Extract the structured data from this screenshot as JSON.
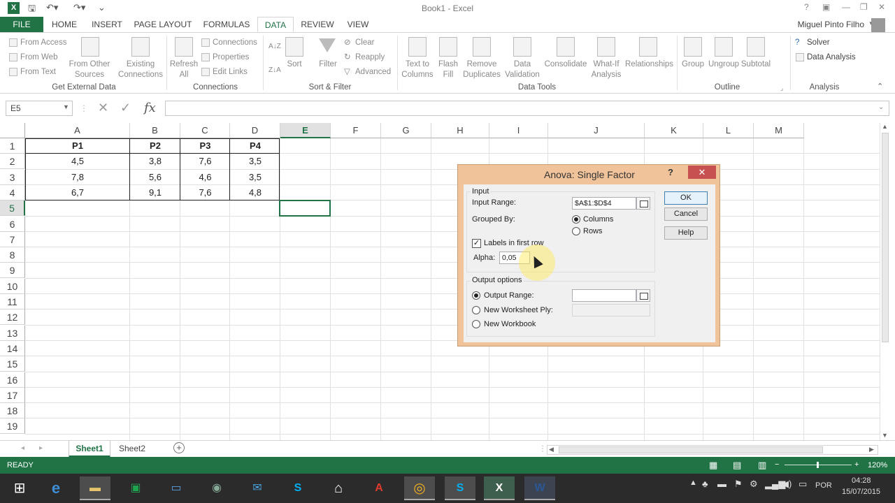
{
  "app": {
    "window_title": "Book1 - Excel",
    "user_name": "Miguel Pinto Filho",
    "qat_icons": [
      "excel-logo",
      "save-icon",
      "undo-icon",
      "redo-icon",
      "customize-qat-icon"
    ]
  },
  "ribbon_tabs": [
    "FILE",
    "HOME",
    "INSERT",
    "PAGE LAYOUT",
    "FORMULAS",
    "DATA",
    "REVIEW",
    "VIEW"
  ],
  "active_tab": "DATA",
  "ribbon": {
    "get_external": {
      "from_access": "From Access",
      "from_web": "From Web",
      "from_text": "From Text",
      "from_other_1": "From Other",
      "from_other_2": "Sources",
      "existing_1": "Existing",
      "existing_2": "Connections",
      "group_label": "Get External Data"
    },
    "connections": {
      "refresh_1": "Refresh",
      "refresh_2": "All",
      "connections": "Connections",
      "properties": "Properties",
      "edit_links": "Edit Links",
      "group_label": "Connections"
    },
    "sort_filter": {
      "sort": "Sort",
      "filter": "Filter",
      "clear": "Clear",
      "reapply": "Reapply",
      "advanced": "Advanced",
      "group_label": "Sort & Filter"
    },
    "data_tools": {
      "text_to_columns_1": "Text to",
      "text_to_columns_2": "Columns",
      "flash_fill_1": "Flash",
      "flash_fill_2": "Fill",
      "remove_duplicates_1": "Remove",
      "remove_duplicates_2": "Duplicates",
      "data_validation_1": "Data",
      "data_validation_2": "Validation",
      "consolidate": "Consolidate",
      "what_if_1": "What-If",
      "what_if_2": "Analysis",
      "relationships": "Relationships",
      "group_label": "Data Tools"
    },
    "outline": {
      "group": "Group",
      "ungroup": "Ungroup",
      "subtotal": "Subtotal",
      "group_label": "Outline"
    },
    "analysis": {
      "solver": "Solver",
      "data_analysis": "Data Analysis",
      "group_label": "Analysis"
    }
  },
  "formula_bar": {
    "name_box": "E5",
    "fx": "fx",
    "formula": ""
  },
  "grid": {
    "columns": [
      "A",
      "B",
      "C",
      "D",
      "E",
      "F",
      "G",
      "H",
      "I",
      "J",
      "K",
      "L",
      "M"
    ],
    "rows": [
      "1",
      "2",
      "3",
      "4",
      "5",
      "6",
      "7",
      "8",
      "9",
      "10",
      "11",
      "12",
      "13",
      "14",
      "15",
      "16",
      "17",
      "18",
      "19"
    ],
    "selected_cell": "E5",
    "table": {
      "headers": [
        "P1",
        "P2",
        "P3",
        "P4"
      ],
      "rows": [
        [
          "4,5",
          "3,8",
          "7,6",
          "3,5"
        ],
        [
          "7,8",
          "5,6",
          "4,6",
          "3,5"
        ],
        [
          "6,7",
          "9,1",
          "7,6",
          "4,8"
        ]
      ]
    }
  },
  "sheets": {
    "tabs": [
      "Sheet1",
      "Sheet2"
    ],
    "active": "Sheet1",
    "add_icon": "plus-circle-icon"
  },
  "status": {
    "ready": "READY",
    "zoom": "120%"
  },
  "dialog": {
    "title": "Anova: Single Factor",
    "help_glyph": "?",
    "close_glyph": "✕",
    "input_section": "Input",
    "input_range_label": "Input Range:",
    "input_range_value": "$A$1:$D$4",
    "grouped_by_label": "Grouped By:",
    "columns_option": "Columns",
    "rows_option": "Rows",
    "grouped_by_selected": "Columns",
    "labels_first_row": "Labels in first row",
    "labels_checked": true,
    "alpha_label": "Alpha:",
    "alpha_value": "0,05",
    "output_section": "Output options",
    "output_range": "Output Range:",
    "new_worksheet": "New Worksheet Ply:",
    "new_workbook": "New Workbook",
    "output_selected": "Output Range",
    "ok": "OK",
    "cancel": "Cancel",
    "help": "Help"
  },
  "taskbar": {
    "apps": [
      "windows-logo",
      "internet-explorer",
      "file-explorer",
      "store",
      "remote-desktop",
      "media-app",
      "mail",
      "skype",
      "home-icon",
      "acrobat",
      "chrome",
      "skype-alt",
      "excel",
      "word"
    ],
    "language": "POR",
    "time": "04:28",
    "date": "15/07/2015"
  }
}
